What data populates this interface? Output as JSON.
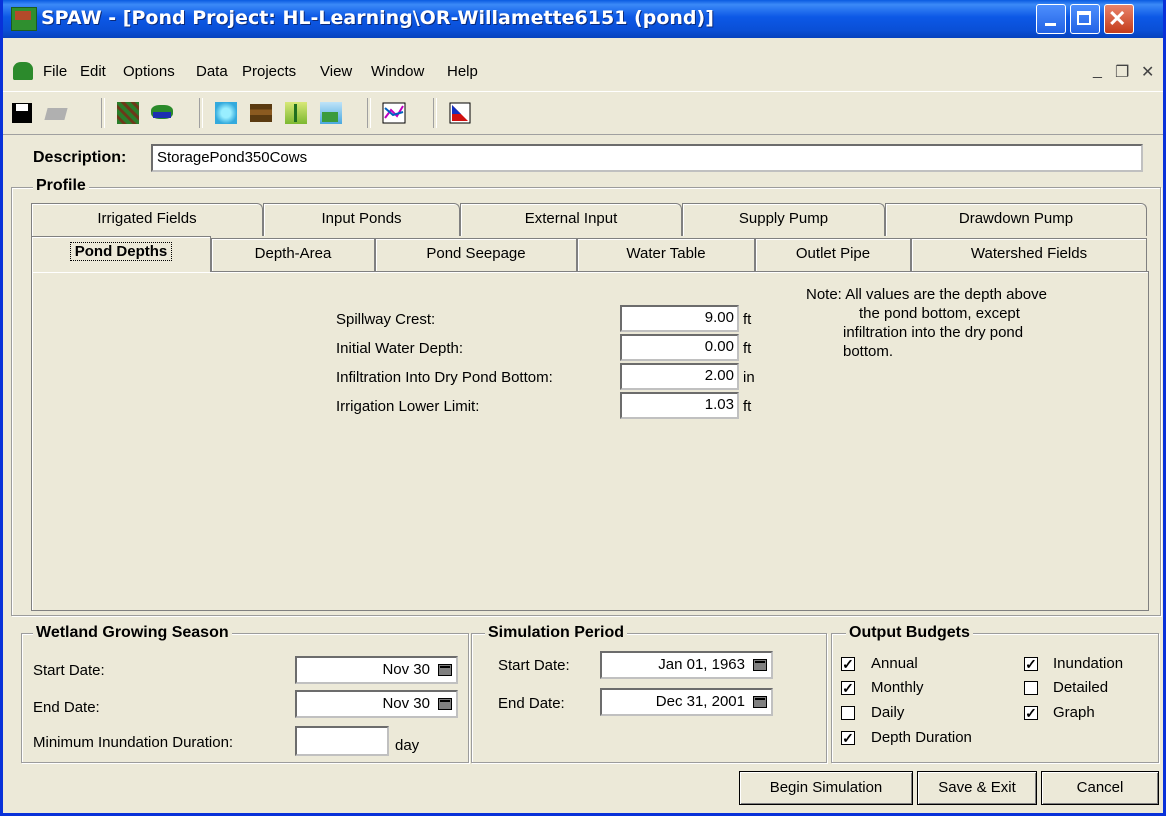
{
  "window": {
    "title": "SPAW - [Pond Project: HL-Learning\\OR-Willamette6151 (pond)]"
  },
  "menu": {
    "items": [
      "File",
      "Edit",
      "Options",
      "Data",
      "Projects",
      "View",
      "Window",
      "Help"
    ]
  },
  "toolbar": {
    "icons": [
      "save-icon",
      "print-icon",
      "field-icon",
      "pond-icon",
      "soil-texture-icon",
      "soil-layer-icon",
      "crop-icon",
      "weather-icon",
      "graph-icon",
      "output-icon"
    ]
  },
  "description": {
    "label": "Description:",
    "value": "StoragePond350Cows"
  },
  "profile": {
    "title": "Profile",
    "tabs_row1": [
      "Irrigated Fields",
      "Input Ponds",
      "External Input",
      "Supply Pump",
      "Drawdown Pump"
    ],
    "tabs_row2": [
      "Pond Depths",
      "Depth-Area",
      "Pond Seepage",
      "Water Table",
      "Outlet Pipe",
      "Watershed Fields"
    ],
    "active_tab": "Pond Depths"
  },
  "pond_depths": {
    "fields": [
      {
        "label": "Spillway Crest:",
        "value": "9.00",
        "unit": "ft"
      },
      {
        "label": "Initial Water Depth:",
        "value": "0.00",
        "unit": "ft"
      },
      {
        "label": "Infiltration Into Dry Pond Bottom:",
        "value": "2.00",
        "unit": "in"
      },
      {
        "label": "Irrigation Lower Limit:",
        "value": "1.03",
        "unit": "ft"
      }
    ],
    "note_lines": [
      "Note: All values are the depth above",
      "the pond bottom, except",
      "infiltration into the dry pond",
      "bottom."
    ]
  },
  "growing_season": {
    "title": "Wetland Growing Season",
    "start_label": "Start Date:",
    "start_value": "Nov 30",
    "end_label": "End Date:",
    "end_value": "Nov 30",
    "duration_label": "Minimum Inundation Duration:",
    "duration_value": "",
    "duration_unit": "day"
  },
  "simulation_period": {
    "title": "Simulation Period",
    "start_label": "Start Date:",
    "start_value": "Jan 01, 1963",
    "end_label": "End Date:",
    "end_value": "Dec 31, 2001"
  },
  "output_budgets": {
    "title": "Output Budgets",
    "items": [
      {
        "label": "Annual",
        "checked": true
      },
      {
        "label": "Monthly",
        "checked": true
      },
      {
        "label": "Daily",
        "checked": false
      },
      {
        "label": "Depth Duration",
        "checked": true
      },
      {
        "label": "Inundation",
        "checked": true
      },
      {
        "label": "Detailed",
        "checked": false
      },
      {
        "label": "Graph",
        "checked": true
      }
    ]
  },
  "buttons": {
    "begin": "Begin Simulation",
    "save_exit": "Save & Exit",
    "cancel": "Cancel"
  }
}
